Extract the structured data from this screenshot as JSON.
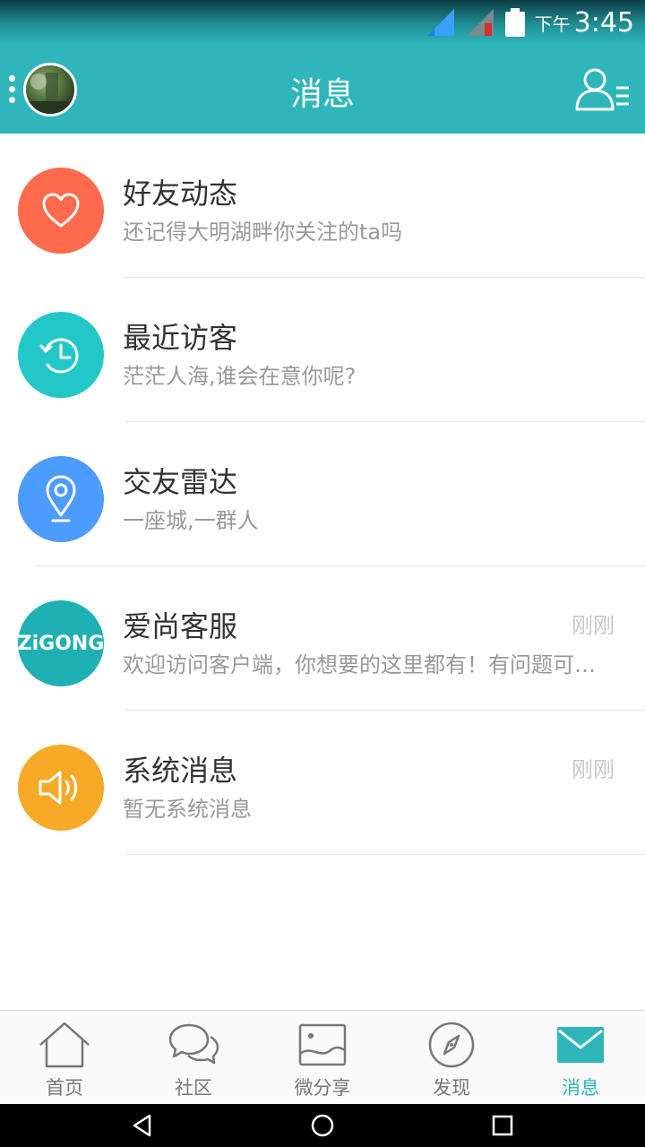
{
  "status": {
    "ampm": "下午",
    "time": "3:45"
  },
  "header": {
    "title": "消息"
  },
  "items": [
    {
      "title": "好友动态",
      "subtitle": "还记得大明湖畔你关注的ta吗",
      "time": "",
      "color": "#ff6a4d",
      "icon": "heart-icon"
    },
    {
      "title": "最近访客",
      "subtitle": "茫茫人海,谁会在意你呢?",
      "time": "",
      "color": "#22c8c8",
      "icon": "clock-history-icon"
    },
    {
      "title": "交友雷达",
      "subtitle": "一座城,一群人",
      "time": "",
      "color": "#4c9bff",
      "icon": "location-pin-icon"
    },
    {
      "title": "爱尚客服",
      "subtitle": "欢迎访问客户端，你想要的这里都有！有问题可以随时咨询我们哦",
      "time": "刚刚",
      "color": "#1fb0b4",
      "icon": "zigong-logo",
      "logo_text": "ZiGONG"
    },
    {
      "title": "系统消息",
      "subtitle": "暂无系统消息",
      "time": "刚刚",
      "color": "#f7a928",
      "icon": "speaker-icon"
    }
  ],
  "tabs": [
    {
      "label": "首页",
      "icon": "home-icon"
    },
    {
      "label": "社区",
      "icon": "chat-bubbles-icon"
    },
    {
      "label": "微分享",
      "icon": "image-icon"
    },
    {
      "label": "发现",
      "icon": "compass-icon"
    },
    {
      "label": "消息",
      "icon": "mail-icon",
      "active": true
    }
  ],
  "colors": {
    "primary": "#2fb6bb",
    "tab_inactive": "#777777"
  }
}
